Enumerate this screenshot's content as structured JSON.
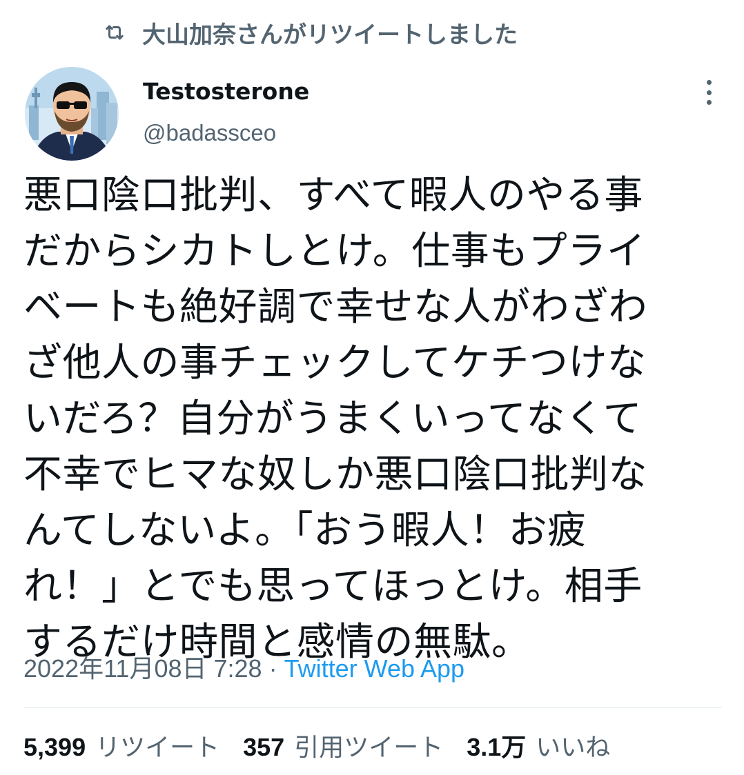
{
  "social_context": {
    "text": "大山加奈さんがリツイートしました",
    "icon": "retweet-icon"
  },
  "author": {
    "display_name": "Testosterone",
    "handle": "@badassceo",
    "avatar": "avatar-illustration"
  },
  "tweet": {
    "lines": [
      "悪口陰口批判、すべて暇人のやる事",
      "だからシカトしとけ。仕事もプライ",
      "ベートも絶好調で幸せな人がわざわ",
      "ざ他人の事チェックしてケチつけな",
      "いだろ？自分がうまくいってなくて",
      "不幸でヒマな奴しか悪口陰口批判な",
      "んてしないよ。「おう暇人！お疲",
      "れ！」とでも思ってほっとけ。相手",
      "するだけ時間と感情の無駄。"
    ]
  },
  "meta": {
    "timestamp": "2022年11月08日 7:28",
    "separator": "·",
    "source": "Twitter Web App"
  },
  "stats": {
    "retweets_count": "5,399",
    "retweets_label": "リツイート",
    "quotes_count": "357",
    "quotes_label": "引用ツイート",
    "likes_count": "3.1万",
    "likes_label": "いいね"
  },
  "colors": {
    "text_primary": "#0f1419",
    "text_secondary": "#536471",
    "link": "#1d9bf0",
    "divider": "#eff3f4"
  }
}
